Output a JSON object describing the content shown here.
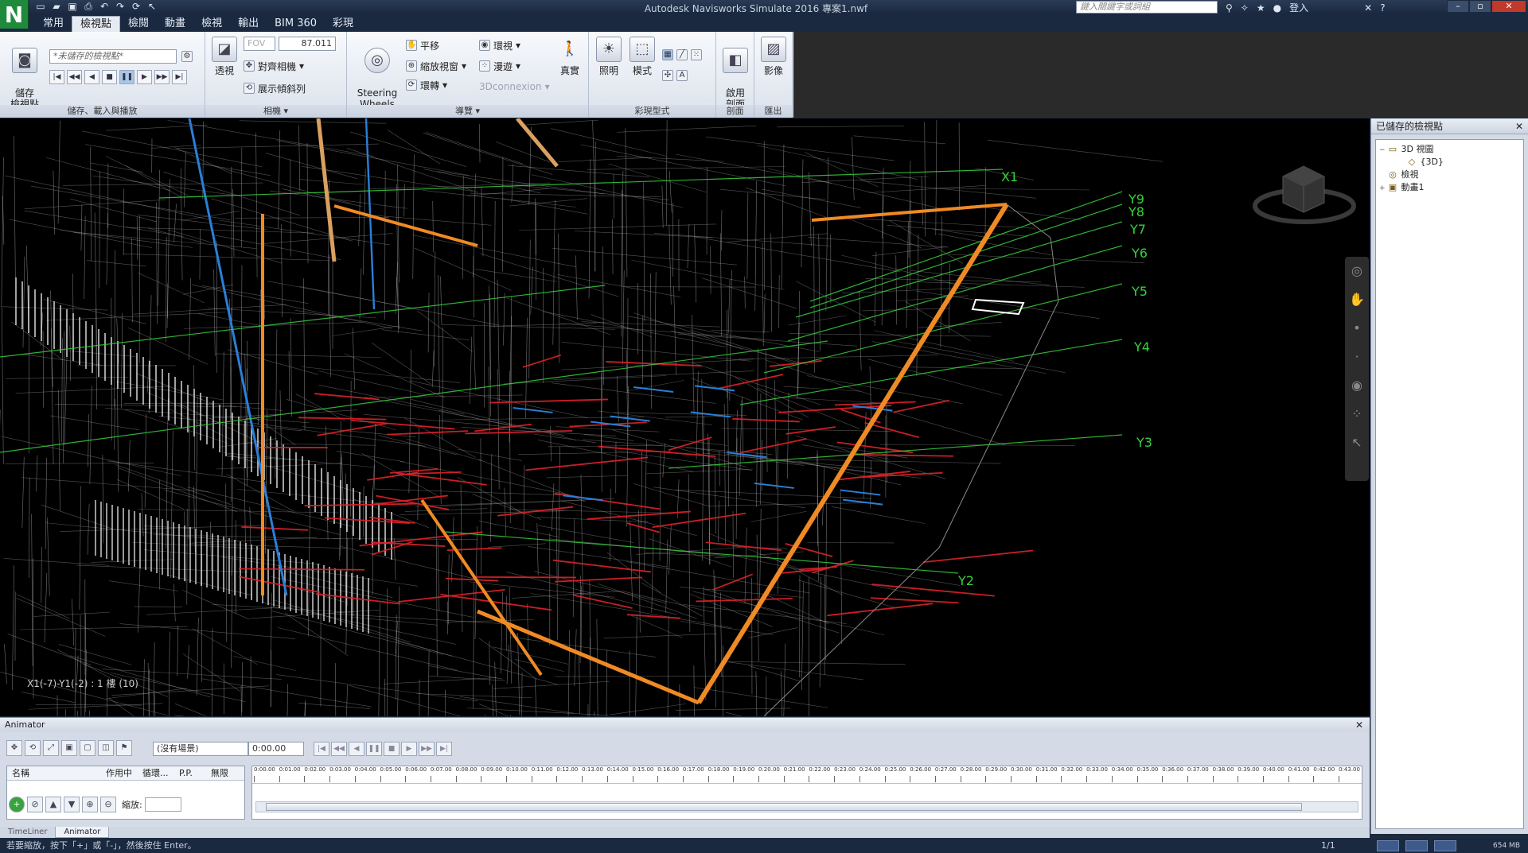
{
  "titlebar": {
    "title": "Autodesk Navisworks Simulate 2016    專案1.nwf",
    "search_placeholder": "鍵入關鍵字或詞組",
    "login": "登入",
    "help": "?"
  },
  "tabs": [
    "常用",
    "檢視點",
    "檢閱",
    "動畫",
    "檢視",
    "輸出",
    "BIM 360",
    "彩現"
  ],
  "active_tab": "檢視點",
  "ribbon": {
    "save_viewpoint": "儲存\n檢視點",
    "viewpoint_combo": "*未儲存的檢視點*",
    "group_save": "儲存、載入與播放",
    "perspective": "透視",
    "fov_label": "FOV",
    "fov_value": "87.011",
    "align_camera": "對齊相機",
    "show_tilt": "展示傾斜列",
    "group_camera": "相機",
    "steering_wheels": "Steering\nWheels",
    "pan": "平移",
    "zoom_window": "縮放視窗",
    "orbit": "環轉",
    "look_around": "環視",
    "walk": "漫遊",
    "connexion": "3Dconnexion",
    "realism": "真實",
    "group_navigate": "導覽",
    "lighting": "照明",
    "mode": "模式",
    "group_render_style": "彩現型式",
    "enable_section": "啟用\n剖面",
    "group_section": "剖面",
    "image": "影像",
    "group_export": "匯出"
  },
  "viewport": {
    "coord_readout": "X1(-7)-Y1(-2) : 1 樓 (10)",
    "grid_labels": [
      "Y9",
      "Y8",
      "Y7",
      "Y6",
      "Y5",
      "Y4",
      "Y3",
      "Y2",
      "X1"
    ]
  },
  "saved_viewpoints_panel": {
    "title": "已儲存的檢視點",
    "items": [
      {
        "label": "3D 視圖",
        "level": 0,
        "toggle": "−",
        "icon": "folder-icon"
      },
      {
        "label": "{3D}",
        "level": 1,
        "toggle": "",
        "icon": "cube-icon"
      },
      {
        "label": "檢視",
        "level": 0,
        "toggle": "",
        "icon": "view-icon"
      },
      {
        "label": "動畫1",
        "level": 0,
        "toggle": "+",
        "icon": "animation-icon"
      }
    ]
  },
  "animator": {
    "title": "Animator",
    "scene_combo": "(沒有場景)",
    "time": "0:00.00",
    "columns": [
      "名稱",
      "作用中",
      "循環...",
      "P.P.",
      "無限"
    ],
    "zoom_label": "縮放:",
    "ticks": [
      "0:00.00",
      "0:01.00",
      "0:02.00",
      "0:03.00",
      "0:04.00",
      "0:05.00",
      "0:06.00",
      "0:07.00",
      "0:08.00",
      "0:09.00",
      "0:10.00",
      "0:11.00",
      "0:12.00",
      "0:13.00",
      "0:14.00",
      "0:15.00",
      "0:16.00",
      "0:17.00",
      "0:18.00",
      "0:19.00",
      "0:20.00",
      "0:21.00",
      "0:22.00",
      "0:23.00",
      "0:24.00",
      "0:25.00",
      "0:26.00",
      "0:27.00",
      "0:28.00",
      "0:29.00",
      "0:30.00",
      "0:31.00",
      "0:32.00",
      "0:33.00",
      "0:34.00",
      "0:35.00",
      "0:36.00",
      "0:37.00",
      "0:38.00",
      "0:39.00",
      "0:40.00",
      "0:41.00",
      "0:42.00",
      "0:43.00"
    ]
  },
  "bottom_tabs": [
    "TimeLiner",
    "Animator"
  ],
  "active_bottom_tab": "Animator",
  "status": {
    "message": "若要縮放，按下「+」或「-」，然後按住 Enter。",
    "page": "1/1",
    "memory": "654 MB"
  },
  "colors": {
    "accent": "#1f8a3c",
    "grid_green": "#37d23c",
    "pipe_orange": "#f08a24",
    "pipe_red": "#e0222a",
    "pipe_blue": "#2a7fd8"
  }
}
